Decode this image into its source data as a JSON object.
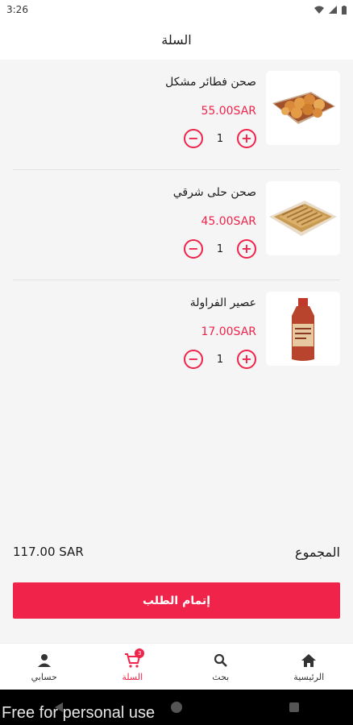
{
  "status_bar": {
    "time": "3:26"
  },
  "header": {
    "title": "السلة"
  },
  "cart": {
    "items": [
      {
        "name": "صحن فطائر مشكل",
        "price": "55.00SAR",
        "quantity": "1",
        "plus": "+",
        "minus": "−"
      },
      {
        "name": "صحن حلى شرقي",
        "price": "45.00SAR",
        "quantity": "1",
        "plus": "+",
        "minus": "−"
      },
      {
        "name": "عصير الفراولة",
        "price": "17.00SAR",
        "quantity": "1",
        "plus": "+",
        "minus": "−"
      }
    ]
  },
  "summary": {
    "total_label": "المجموع",
    "total_value": "117.00 SAR"
  },
  "checkout": {
    "label": "إتمام الطلب"
  },
  "bottom_nav": {
    "items": [
      {
        "label": "حسابي",
        "icon": "person-icon"
      },
      {
        "label": "السلة",
        "icon": "cart-icon",
        "badge": "3"
      },
      {
        "label": "بحث",
        "icon": "search-icon"
      },
      {
        "label": "الرئيسية",
        "icon": "home-icon"
      }
    ]
  },
  "watermark": "Free for personal use",
  "colors": {
    "accent": "#f0234a",
    "background": "#f5f5f5"
  }
}
